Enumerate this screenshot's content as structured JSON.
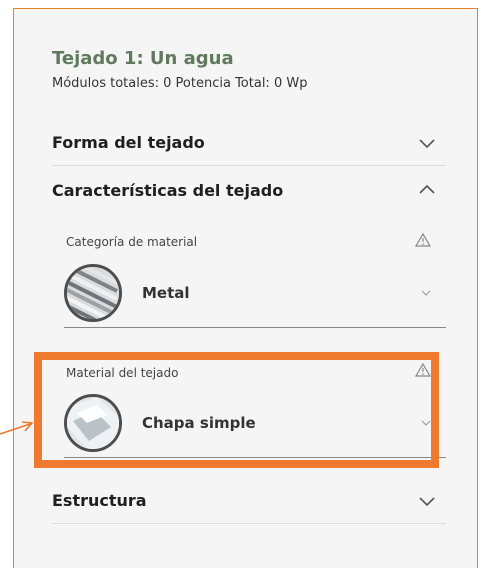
{
  "header": {
    "title": "Tejado 1: Un agua",
    "subtitle": "Módulos totales: 0 Potencia Total: 0 Wp"
  },
  "sections": {
    "shape": {
      "label": "Forma del tejado",
      "icon": "chevron-down-icon"
    },
    "characteristics": {
      "label": "Características del tejado",
      "icon": "chevron-up-icon"
    },
    "structure": {
      "label": "Estructura",
      "icon": "chevron-down-icon"
    }
  },
  "material_category": {
    "label": "Categoría de material",
    "value": "Metal",
    "warning_icon": "warning-triangle-icon"
  },
  "roof_material": {
    "label": "Material del tejado",
    "value": "Chapa simple",
    "warning_icon": "warning-triangle-icon"
  },
  "colors": {
    "title_green": "#5f7a5c",
    "highlight_orange": "#ee7a2d",
    "panel_border": "#e7822f"
  }
}
